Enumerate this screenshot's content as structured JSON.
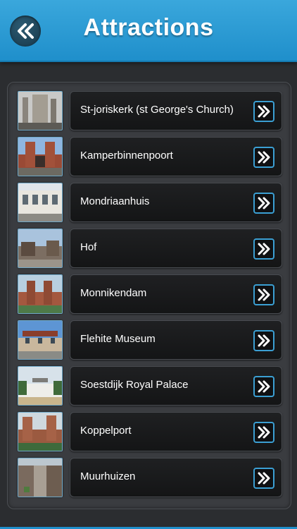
{
  "header": {
    "title": "Attractions",
    "back_icon": "double-chevron-left-icon",
    "color": "#2b9bd5"
  },
  "attractions": [
    {
      "name": "St-joriskerk (st George's Church)"
    },
    {
      "name": "Kamperbinnenpoort"
    },
    {
      "name": "Mondriaanhuis"
    },
    {
      "name": "Hof"
    },
    {
      "name": "Monnikendam"
    },
    {
      "name": "Flehite Museum"
    },
    {
      "name": "Soestdijk Royal Palace"
    },
    {
      "name": "Koppelport"
    },
    {
      "name": "Muurhuizen"
    }
  ],
  "row_action_icon": "double-chevron-right-icon",
  "accent_color": "#3b9fd3"
}
